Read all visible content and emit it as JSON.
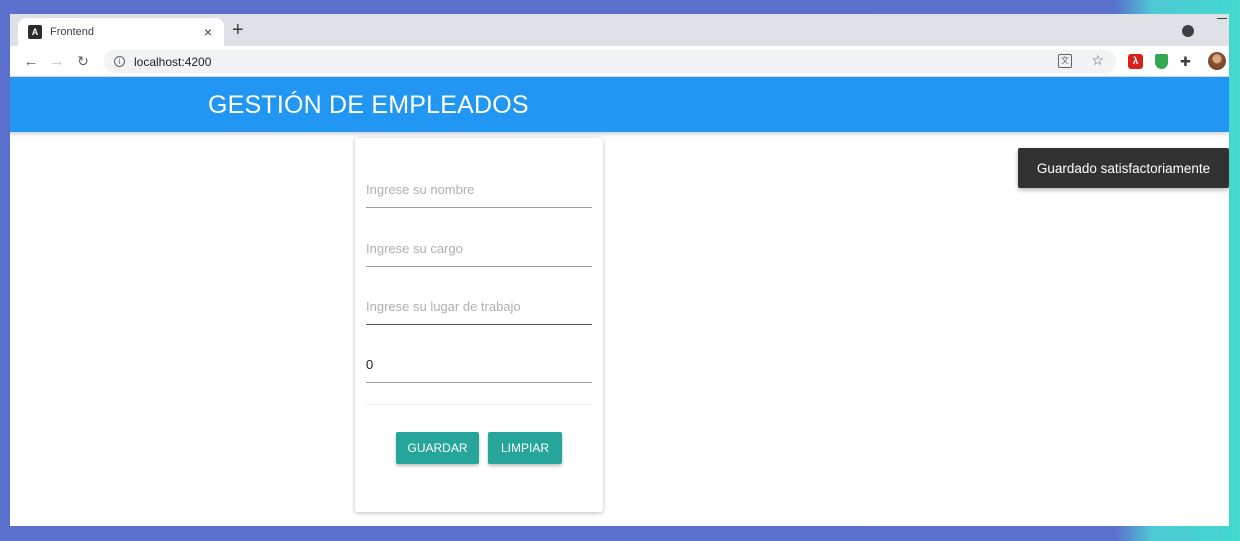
{
  "browser": {
    "tab_title": "Frontend",
    "tab_favicon": "A",
    "tab_close": "×",
    "new_tab": "+",
    "url": "localhost:4200",
    "icons": [
      "back-arrow-icon",
      "forward-arrow-icon",
      "reload-icon",
      "info-icon",
      "translate-icon",
      "star-icon",
      "pdf-extension-icon",
      "shield-extension-icon",
      "puzzle-extensions-icon",
      "profile-avatar"
    ]
  },
  "app": {
    "title": "GESTIÓN DE EMPLEADOS",
    "form": {
      "name_placeholder": "Ingrese su nombre",
      "position_placeholder": "Ingrese su cargo",
      "workplace_placeholder": "Ingrese su lugar de trabajo",
      "salary_value": "0",
      "save_label": "GUARDAR",
      "clear_label": "LIMPIAR"
    },
    "toast": "Guardado satisfactoriamente"
  },
  "colors": {
    "header": "#2196f3",
    "button": "#26a69a",
    "toast": "#323232"
  }
}
